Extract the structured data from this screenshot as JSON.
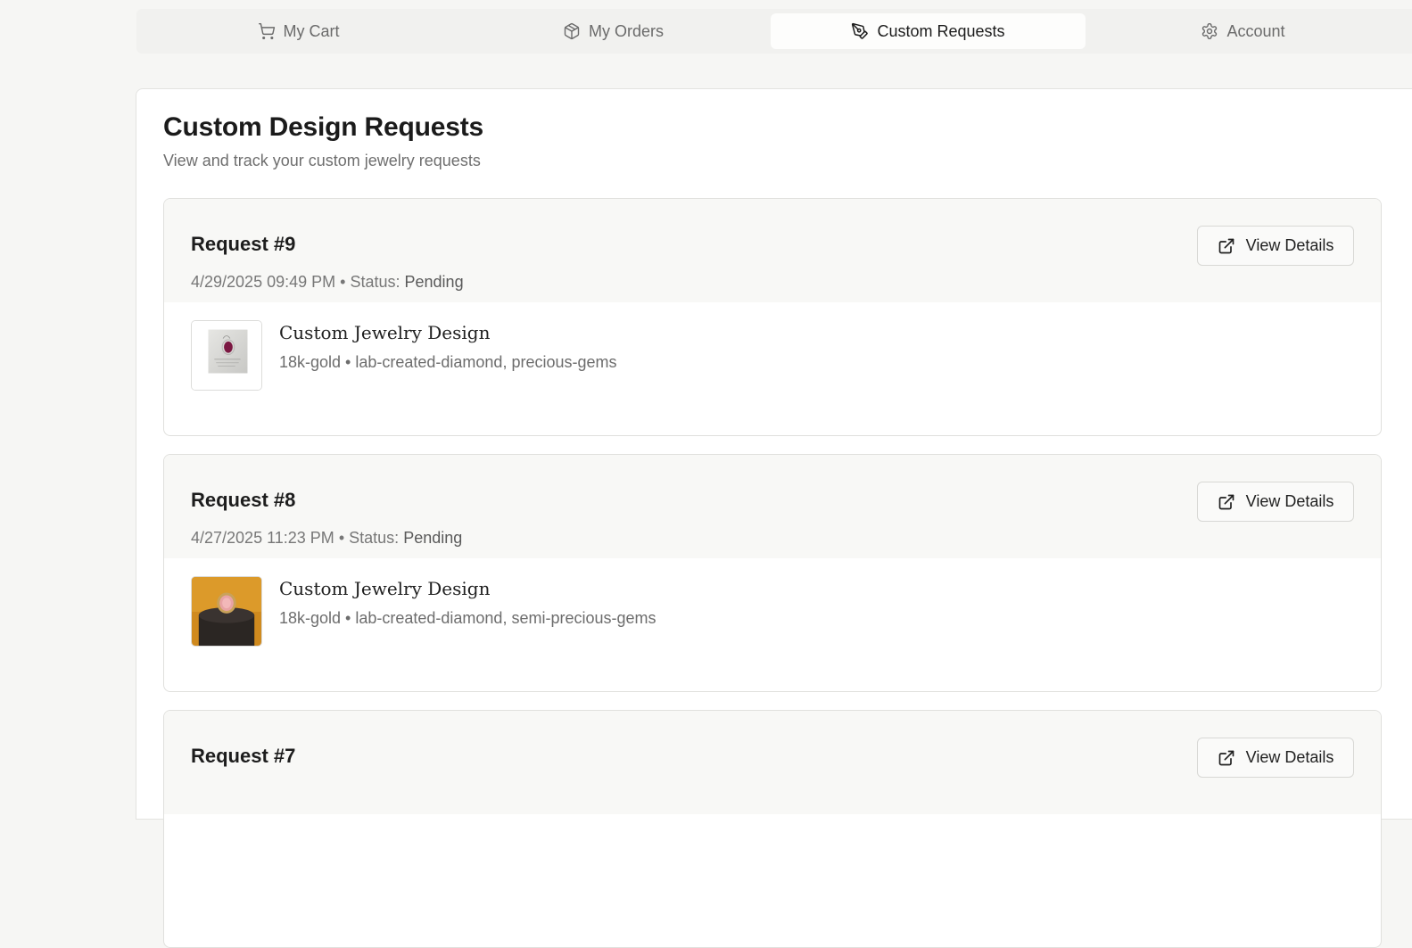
{
  "tabs": [
    {
      "label": "My Cart",
      "icon": "cart-icon",
      "active": false
    },
    {
      "label": "My Orders",
      "icon": "package-icon",
      "active": false
    },
    {
      "label": "Custom Requests",
      "icon": "pen-tool-icon",
      "active": true
    },
    {
      "label": "Account",
      "icon": "gear-icon",
      "active": false
    }
  ],
  "page": {
    "title": "Custom Design Requests",
    "subtitle": "View and track your custom jewelry requests"
  },
  "requests": [
    {
      "title": "Request #9",
      "date": "4/29/2025 09:49 PM",
      "separator": "•",
      "status_label": "Status:",
      "status": "Pending",
      "button_label": "View Details",
      "item": {
        "name": "Custom Jewelry Design",
        "specs": "18k-gold • lab-created-diamond, precious-gems",
        "thumbnail": "ruby-pendant-sketch"
      }
    },
    {
      "title": "Request #8",
      "date": "4/27/2025 11:23 PM",
      "separator": "•",
      "status_label": "Status:",
      "status": "Pending",
      "button_label": "View Details",
      "item": {
        "name": "Custom Jewelry Design",
        "specs": "18k-gold • lab-created-diamond, semi-precious-gems",
        "thumbnail": "pink-stone-ring-on-stand"
      }
    },
    {
      "title": "Request #7",
      "button_label": "View Details"
    }
  ],
  "colors": {
    "background": "#f6f6f4",
    "tabbar": "#f1f1ef",
    "active_tab": "#fdfdfc",
    "card_header": "#f8f8f6",
    "border": "#e0e0dd"
  }
}
